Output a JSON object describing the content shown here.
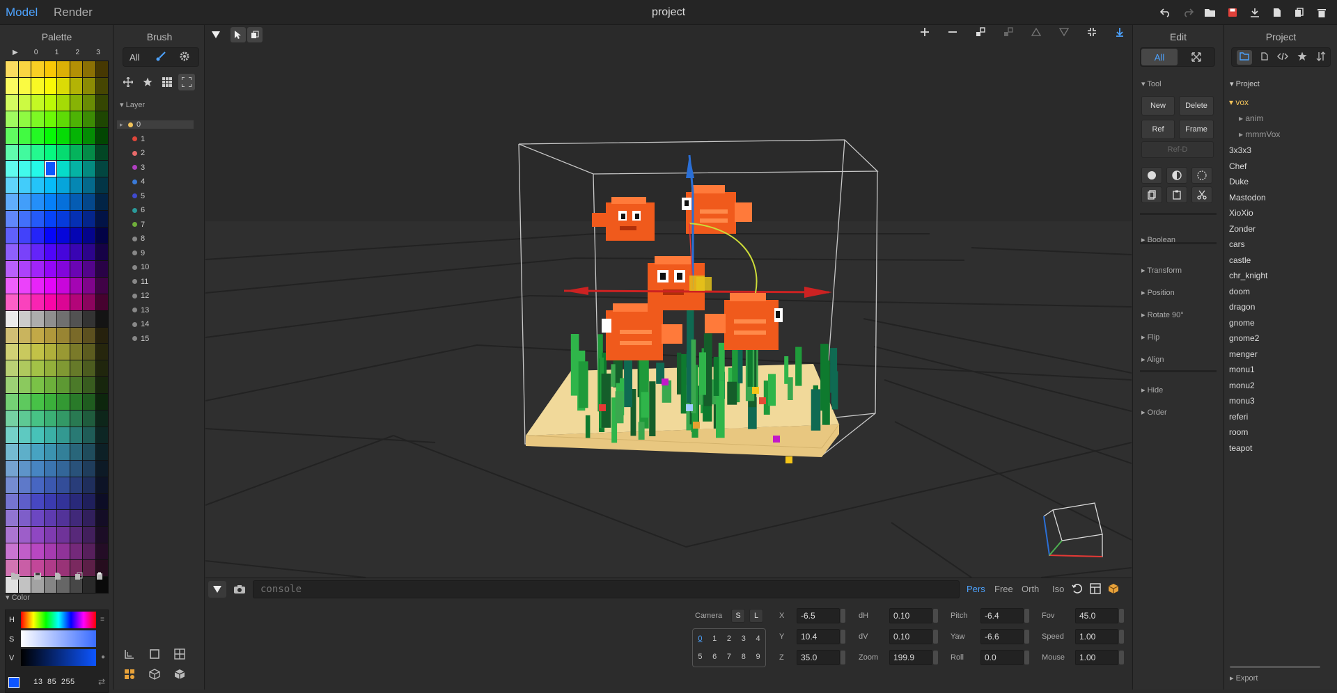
{
  "header": {
    "mode_model": "Model",
    "mode_render": "Render",
    "title": "project"
  },
  "palette": {
    "title": "Palette",
    "columns": [
      "▶",
      "0",
      "1",
      "2",
      "3"
    ],
    "selected_color": "#0d55ff",
    "color_section": "Color",
    "hsv_labels": [
      "H",
      "S",
      "V"
    ],
    "rgb_value": "13 85 255"
  },
  "brush": {
    "title": "Brush",
    "filter": "All",
    "layer_section": "Layer",
    "layers": [
      {
        "label": "0",
        "color": "#f2c35a"
      },
      {
        "label": "1",
        "color": "#e0463a"
      },
      {
        "label": "2",
        "color": "#e86a6a"
      },
      {
        "label": "3",
        "color": "#b03fc0"
      },
      {
        "label": "4",
        "color": "#3a7ad8"
      },
      {
        "label": "5",
        "color": "#3f4ad0"
      },
      {
        "label": "6",
        "color": "#2a9a9a"
      },
      {
        "label": "7",
        "color": "#6fae3a"
      },
      {
        "label": "8",
        "color": "#888888"
      },
      {
        "label": "9",
        "color": "#888888"
      },
      {
        "label": "10",
        "color": "#888888"
      },
      {
        "label": "11",
        "color": "#888888"
      },
      {
        "label": "12",
        "color": "#888888"
      },
      {
        "label": "13",
        "color": "#888888"
      },
      {
        "label": "14",
        "color": "#888888"
      },
      {
        "label": "15",
        "color": "#888888"
      }
    ]
  },
  "console": {
    "placeholder": "console",
    "views": [
      "Pers",
      "Free",
      "Orth",
      "Iso"
    ],
    "active_view": "Pers"
  },
  "camera": {
    "label": "Camera",
    "s_btn": "S",
    "l_btn": "L",
    "slots_row1": [
      "0",
      "1",
      "2",
      "3",
      "4"
    ],
    "slots_row2": [
      "5",
      "6",
      "7",
      "8",
      "9"
    ],
    "x_label": "X",
    "x": "-6.5",
    "y_label": "Y",
    "y": "10.4",
    "z_label": "Z",
    "z": "35.0",
    "dh_label": "dH",
    "dh": "0.10",
    "dv_label": "dV",
    "dv": "0.10",
    "zoom_label": "Zoom",
    "zoom": "199.9",
    "pitch_label": "Pitch",
    "pitch": "-6.4",
    "yaw_label": "Yaw",
    "yaw": "-6.6",
    "roll_label": "Roll",
    "roll": "0.0",
    "fov_label": "Fov",
    "fov": "45.0",
    "speed_label": "Speed",
    "speed": "1.00",
    "mouse_label": "Mouse",
    "mouse": "1.00"
  },
  "edit": {
    "title": "Edit",
    "filter": "All",
    "tool_section": "Tool",
    "new": "New",
    "delete": "Delete",
    "ref": "Ref",
    "frame": "Frame",
    "ref_d": "Ref-D",
    "sections": [
      "Boolean",
      "Transform",
      "Position",
      "Rotate 90°",
      "Flip",
      "Align",
      "Hide",
      "Order"
    ]
  },
  "project": {
    "title": "Project",
    "section": "Project",
    "folder": "vox",
    "subfolders": [
      "anim",
      "mmmVox"
    ],
    "items": [
      "3x3x3",
      "Chef",
      "Duke",
      "Mastodon",
      "XioXio",
      "Zonder",
      "cars",
      "castle",
      "chr_knight",
      "doom",
      "dragon",
      "gnome",
      "gnome2",
      "menger",
      "monu1",
      "monu2",
      "monu3",
      "referi",
      "room",
      "teapot"
    ],
    "export": "Export"
  }
}
